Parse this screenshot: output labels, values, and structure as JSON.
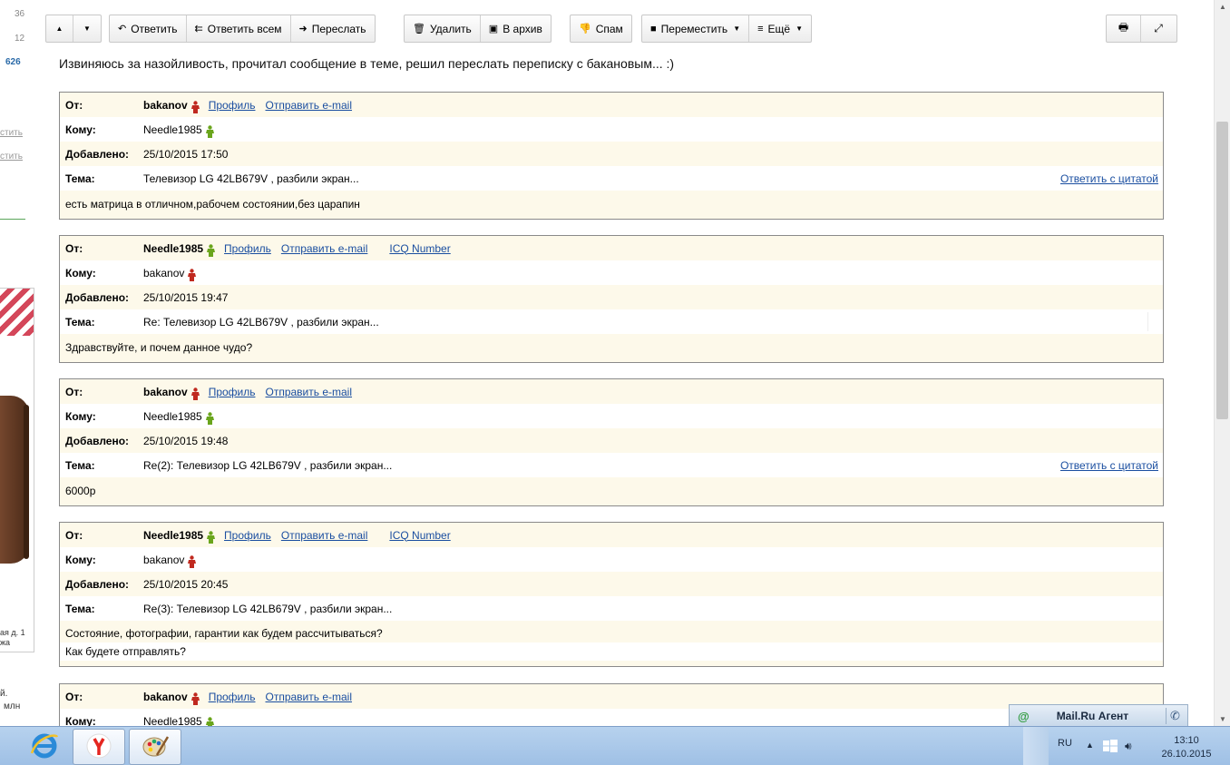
{
  "sidebar": {
    "counter_top": "36",
    "counter_mid": "12",
    "count": "626",
    "link1": "стить",
    "link2": "стить",
    "ad_text_line1": "ая д. 1",
    "ad_text_line2": "жа",
    "bottom_line1": "й.",
    "bottom_line2": "млн"
  },
  "toolbar": {
    "up_icon": "▲",
    "down_icon": "▼",
    "reply": "Ответить",
    "reply_all": "Ответить всем",
    "forward": "Переслать",
    "delete": "Удалить",
    "archive": "В архив",
    "spam": "Спам",
    "move": "Переместить",
    "more": "Ещё"
  },
  "intro": "Извиняюсь за назойливость, прочитал сообщение в теме, решил переслать переписку с бакановым... :)",
  "labels": {
    "from": "От:",
    "to": "Кому:",
    "added": "Добавлено:",
    "subject": "Тема:",
    "profile": "Профиль",
    "send_email": "Отправить e-mail",
    "icq": "ICQ Number",
    "reply_quote": "Ответить с цитатой"
  },
  "messages": [
    {
      "from": "bakanov",
      "from_gender": "male-red",
      "to": "Needle1985",
      "to_gender": "male-green",
      "date": "25/10/2015 17:50",
      "subject": "Телевизор LG 42LB679V , разбили экран...",
      "body": "есть матрица в отличном,рабочем состоянии,без царапин"
    },
    {
      "from": "Needle1985",
      "from_gender": "male-green",
      "to": "bakanov",
      "to_gender": "male-red",
      "date": "25/10/2015 19:47",
      "subject": "Re: Телевизор LG 42LB679V , разбили экран...",
      "body": "Здравствуйте, и почем данное чудо?"
    },
    {
      "from": "bakanov",
      "from_gender": "male-red",
      "to": "Needle1985",
      "to_gender": "male-green",
      "date": "25/10/2015 19:48",
      "subject": "Re(2): Телевизор LG 42LB679V , разбили экран...",
      "body": "6000р"
    },
    {
      "from": "Needle1985",
      "from_gender": "male-green",
      "to": "bakanov",
      "to_gender": "male-red",
      "date": "25/10/2015 20:45",
      "subject": "Re(3): Телевизор LG 42LB679V , разбили экран...",
      "body_line1": "Состояние, фотографии, гарантии как будем рассчитываться?",
      "body_line2": "Как будете отправлять?"
    },
    {
      "from": "bakanov",
      "from_gender": "male-red",
      "to": "Needle1985",
      "to_gender": "male-green"
    }
  ],
  "agent": {
    "title": "Mail.Ru Агент",
    "at_icon": "@",
    "phone_icon": "✆"
  },
  "taskbar": {
    "lang": "RU",
    "time": "13:10",
    "date": "26.10.2015"
  },
  "colors": {
    "card_bg": "#fdf9ea",
    "link": "#1a4ea0",
    "male_red": "#c0291f",
    "male_green": "#6aa51c"
  }
}
